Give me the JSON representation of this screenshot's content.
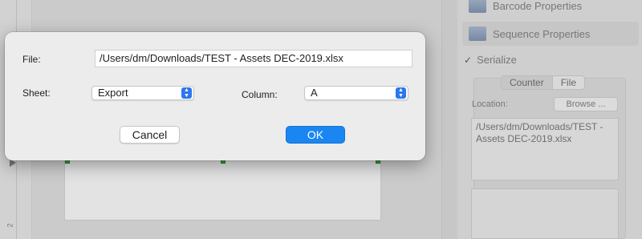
{
  "background": {
    "ruler_mark": "2",
    "sidebar": {
      "barcode_properties": "Barcode Properties",
      "sequence_properties": "Sequence Properties",
      "serialize_label": "Serialize",
      "serialize_check": "✓",
      "tabs": [
        "Counter",
        "File"
      ],
      "active_tab": "File",
      "location_label": "Location:",
      "browse_label": "Browse ...",
      "path_value": "/Users/dm/Downloads/TEST - Assets DEC-2019.xlsx"
    }
  },
  "dialog": {
    "file_label": "File:",
    "file_value": "/Users/dm/Downloads/TEST - Assets DEC-2019.xlsx",
    "sheet_label": "Sheet:",
    "sheet_value": "Export",
    "column_label": "Column:",
    "column_value": "A",
    "cancel_label": "Cancel",
    "ok_label": "OK"
  },
  "colors": {
    "accent": "#1a86f2",
    "stepper": "#2b77f0",
    "handle": "#3a9a3a"
  }
}
